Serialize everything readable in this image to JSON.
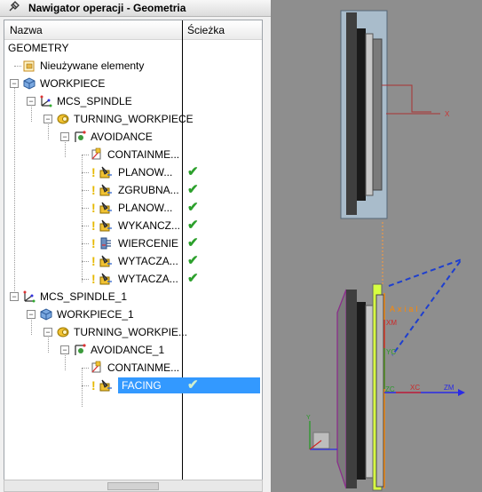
{
  "title": "Nawigator operacji - Geometria",
  "columns": {
    "name": "Nazwa",
    "path": "Ścieżka"
  },
  "tree": [
    {
      "label": "GEOMETRY"
    },
    {
      "label": "Nieużywane elementy"
    },
    {
      "label": "WORKPIECE"
    },
    {
      "label": "MCS_SPINDLE"
    },
    {
      "label": "TURNING_WORKPIECE"
    },
    {
      "label": "AVOIDANCE"
    },
    {
      "label": "CONTAINME..."
    },
    {
      "label": "PLANOW...",
      "path": "✔"
    },
    {
      "label": "ZGRUBNA...",
      "path": "✔"
    },
    {
      "label": "PLANOW...",
      "path": "✔"
    },
    {
      "label": "WYKANCZ...",
      "path": "✔"
    },
    {
      "label": "WIERCENIE",
      "path": "✔"
    },
    {
      "label": "WYTACZA...",
      "path": "✔"
    },
    {
      "label": "WYTACZA...",
      "path": "✔"
    },
    {
      "label": "MCS_SPINDLE_1"
    },
    {
      "label": "WORKPIECE_1"
    },
    {
      "label": "TURNING_WORKPIE..."
    },
    {
      "label": "AVOIDANCE_1"
    },
    {
      "label": "CONTAINME..."
    },
    {
      "label": "FACING",
      "path": "✔",
      "selected": true
    }
  ],
  "viewport_labels": {
    "x_top": "X",
    "axial": "Axial",
    "xm": "XM",
    "yc": "YC",
    "zc_origin": "ZC",
    "xc": "XC",
    "zm": "ZM",
    "y_small": "Y"
  },
  "colors": {
    "selection": "#3399ff",
    "check": "#2ca02c",
    "viewport_bg": "#8e8e8e"
  }
}
